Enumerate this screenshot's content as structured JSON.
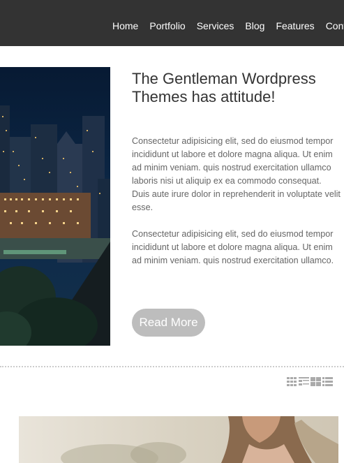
{
  "nav": {
    "items": [
      "Home",
      "Portfolio",
      "Services",
      "Blog",
      "Features",
      "Contact"
    ]
  },
  "post": {
    "title": "The Gentleman Wordpress Themes has attitude!",
    "paragraph1": "Consectetur adipisicing elit, sed do eiusmod tempor incididunt ut labore et dolore magna aliqua. Ut enim ad minim veniam. quis nostrud exercitation ullamco laboris nisi ut aliquip ex ea commodo consequat. Duis aute irure dolor in reprehenderit in voluptate velit esse.",
    "paragraph2": "Consectetur adipisicing elit, sed do eiusmod tempor incididunt ut labore et dolore magna aliqua. Ut enim ad minim veniam. quis nostrud exercitation ullamco.",
    "read_more": "Read More"
  },
  "view_icons": [
    "grid-4-icon",
    "list-thumb-icon",
    "grid-2-icon",
    "list-icon"
  ]
}
